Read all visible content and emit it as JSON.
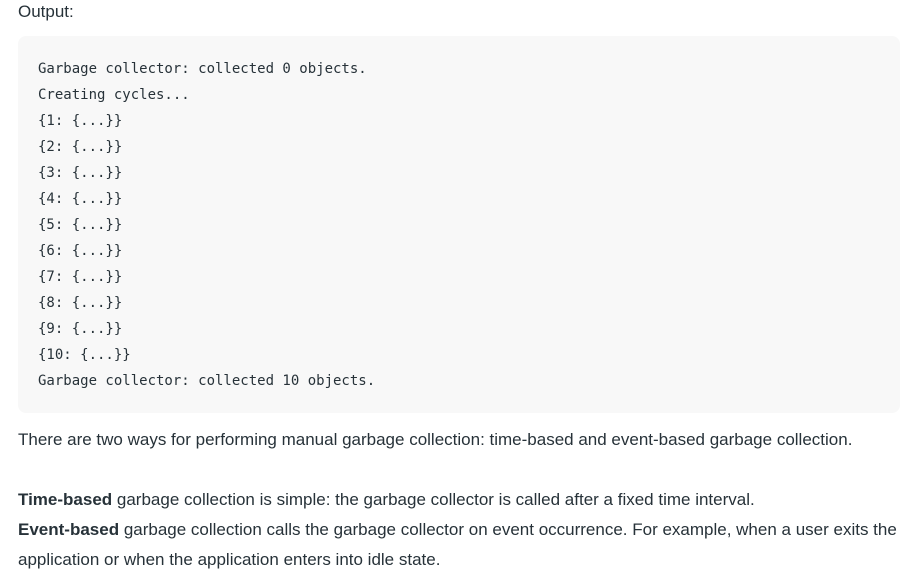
{
  "heading": "Output:",
  "code_lines": [
    "Garbage collector: collected 0 objects.",
    "Creating cycles...",
    "{1: {...}}",
    "{2: {...}}",
    "{3: {...}}",
    "{4: {...}}",
    "{5: {...}}",
    "{6: {...}}",
    "{7: {...}}",
    "{8: {...}}",
    "{9: {...}}",
    "{10: {...}}",
    "Garbage collector: collected 10 objects."
  ],
  "paragraphs": {
    "intro": "There are two ways for performing manual garbage collection: time-based and event-based garbage collection.",
    "time_based_term": "Time-based",
    "time_based_text": " garbage collection is simple: the garbage collector is called after a fixed time interval.",
    "event_based_term": "Event-based",
    "event_based_text": " garbage collection calls the garbage collector on event occurrence. For example, when a user exits the application or when the application enters into idle state."
  }
}
